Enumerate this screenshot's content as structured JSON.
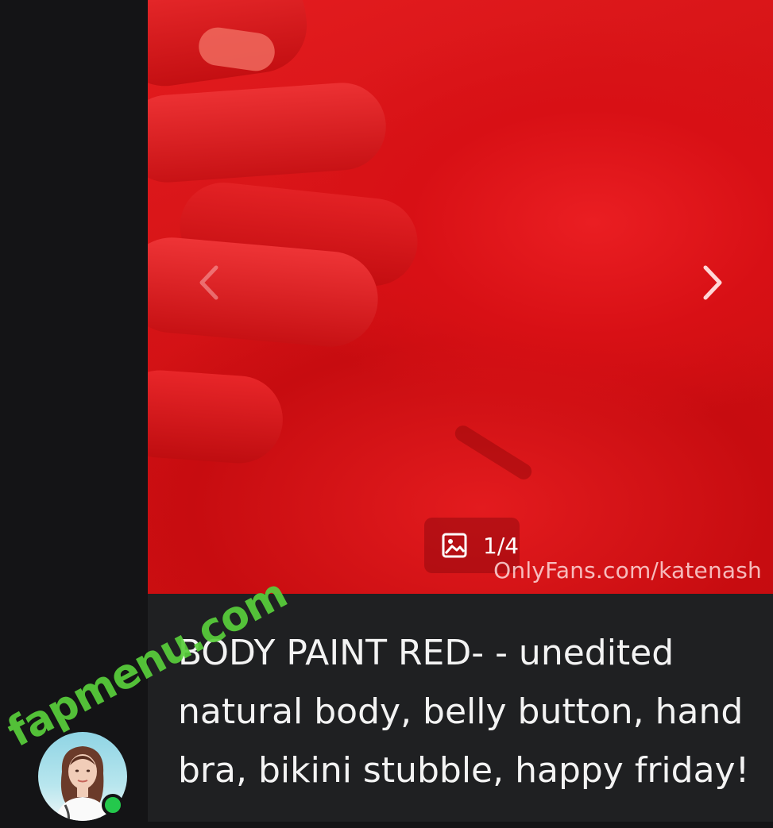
{
  "post": {
    "carousel": {
      "counter": "1/4",
      "watermark": "OnlyFans.com/katenash"
    },
    "caption": "BODY PAINT RED- - unedited natural body, belly button, hand bra, bikini stubble, happy friday!"
  },
  "branding": {
    "site_logo": "fapmenu.com"
  },
  "colors": {
    "background": "#141416",
    "card": "#1f2022",
    "paint_red": "#d81015",
    "logo_green": "#59cf3b",
    "online": "#24c84c"
  },
  "icons": [
    "chevron-left-icon",
    "chevron-right-icon",
    "image-icon"
  ]
}
